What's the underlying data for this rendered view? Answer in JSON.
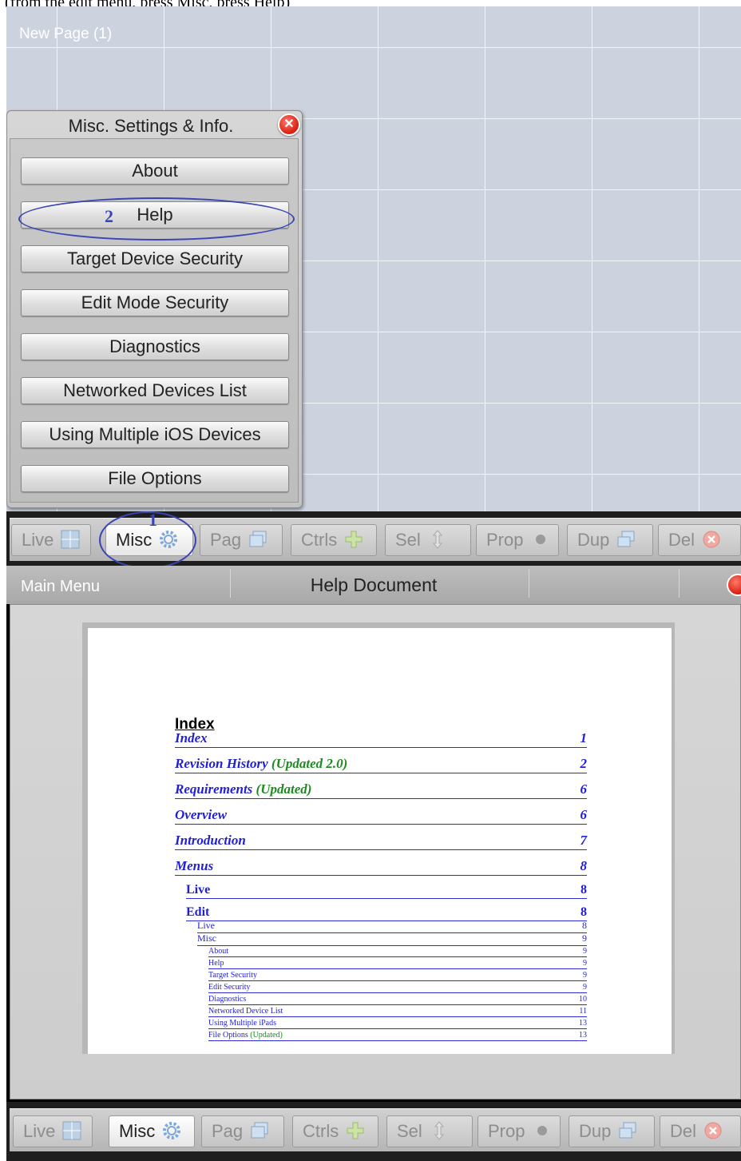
{
  "caption": "(from the edit menu, press Misc, press Help)",
  "edit_screen": {
    "page_title": "New Page (1)",
    "panel": {
      "title": "Misc. Settings & Info.",
      "buttons": [
        "About",
        "Help",
        "Target Device Security",
        "Edit Mode Security",
        "Diagnostics",
        "Networked Devices List",
        "Using Multiple iOS Devices",
        "File Options"
      ]
    },
    "annotations": {
      "step1": "1",
      "step2": "2"
    }
  },
  "toolbar": [
    {
      "label": "Live",
      "icon": "grid-icon",
      "active": false
    },
    {
      "label": "Misc",
      "icon": "gear-icon",
      "active": true
    },
    {
      "label": "Pag",
      "icon": "pages-icon",
      "active": false
    },
    {
      "label": "Ctrls",
      "icon": "plus-icon",
      "active": false
    },
    {
      "label": "Sel",
      "icon": "select-arrows-icon",
      "active": false
    },
    {
      "label": "Prop",
      "icon": "dot-icon",
      "active": false
    },
    {
      "label": "Dup",
      "icon": "duplicate-icon",
      "active": false
    },
    {
      "label": "Del",
      "icon": "delete-icon",
      "active": false
    }
  ],
  "help_screen": {
    "back_label": "Main Menu",
    "title": "Help Document",
    "doc": {
      "heading": "Index",
      "toc": [
        {
          "label": "Index",
          "updated": "",
          "page": "1"
        },
        {
          "label": "Revision History",
          "updated": " (Updated 2.0)",
          "page": "2"
        },
        {
          "label": "Requirements",
          "updated": " (Updated)",
          "page": "6"
        },
        {
          "label": "Overview",
          "updated": "",
          "page": "6"
        },
        {
          "label": "Introduction",
          "updated": "",
          "page": "7"
        },
        {
          "label": "Menus",
          "updated": "",
          "page": "8"
        },
        {
          "label": "Live",
          "updated": "",
          "page": "8"
        },
        {
          "label": "Edit",
          "updated": "",
          "page": "8"
        },
        {
          "label": "Live",
          "updated": "",
          "page": "8"
        },
        {
          "label": "Misc",
          "updated": "",
          "page": "9"
        },
        {
          "label": "About",
          "updated": "",
          "page": "9"
        },
        {
          "label": "Help",
          "updated": "",
          "page": "9"
        },
        {
          "label": "Target Security",
          "updated": "",
          "page": "9"
        },
        {
          "label": "Edit Security",
          "updated": "",
          "page": "9"
        },
        {
          "label": "Diagnostics",
          "updated": "",
          "page": "10"
        },
        {
          "label": "Networked Device List",
          "updated": "",
          "page": "11"
        },
        {
          "label": "Using Multiple iPads",
          "updated": "",
          "page": "13"
        },
        {
          "label": "File Options",
          "updated": " (Updated)",
          "page": "13"
        }
      ]
    }
  }
}
